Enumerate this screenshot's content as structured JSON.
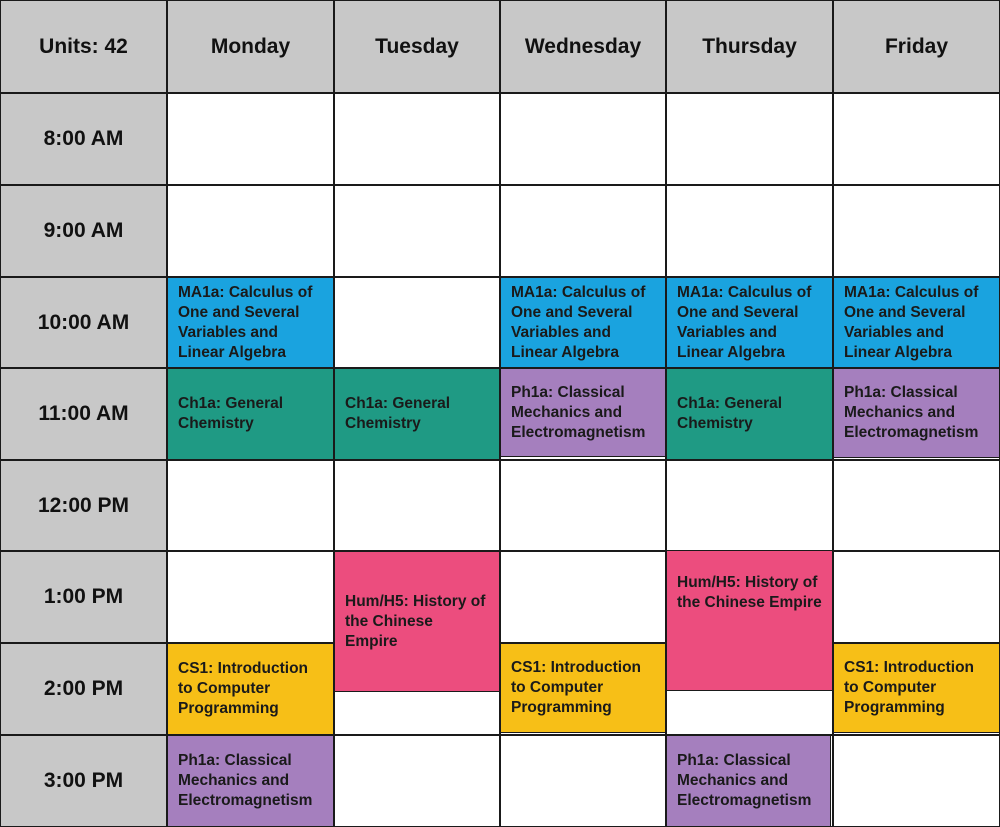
{
  "header": {
    "units": "Units: 42",
    "days": [
      "Monday",
      "Tuesday",
      "Wednesday",
      "Thursday",
      "Friday"
    ]
  },
  "times": [
    "8:00 AM",
    "9:00 AM",
    "10:00 AM",
    "11:00  AM",
    "12:00 PM",
    "1:00 PM",
    "2:00 PM",
    "3:00 PM"
  ],
  "courses": {
    "ma1a": "MA1a: Calculus of One and Several Variables and Linear Algebra",
    "ch1a": "Ch1a: General Chemistry",
    "ph1a": "Ph1a: Classical Mechanics and Electromagnetism",
    "hum": "Hum/H5: History of the Chinese Empire",
    "cs1": "CS1: Introduction to Computer Programming"
  },
  "colors": {
    "header_bg": "#c8c8c8",
    "ma1a": "#1aa3df",
    "ch1a": "#1f9a84",
    "ph1a": "#a57fbe",
    "hum": "#ec4d7e",
    "cs1": "#f7bf17"
  }
}
